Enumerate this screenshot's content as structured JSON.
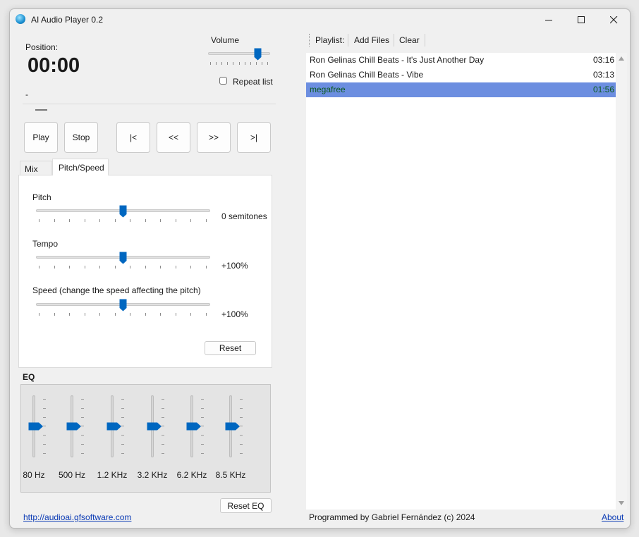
{
  "window": {
    "title": "AI Audio Player 0.2"
  },
  "position": {
    "label": "Position:",
    "time": "00:00",
    "status": "-"
  },
  "volume": {
    "label": "Volume",
    "level": 0.8
  },
  "repeat": {
    "label": "Repeat list",
    "checked": false
  },
  "transport": {
    "play": "Play",
    "stop": "Stop",
    "first": "|<",
    "rewind": "<<",
    "forward": ">>",
    "last": ">|"
  },
  "tabs": [
    {
      "label": "Mix",
      "active": false
    },
    {
      "label": "Pitch/Speed",
      "active": true
    }
  ],
  "pitch_speed": {
    "pitch": {
      "label": "Pitch",
      "value": "0 semitones",
      "level": 0.5
    },
    "tempo": {
      "label": "Tempo",
      "value": "+100%",
      "level": 0.5
    },
    "speed": {
      "label": "Speed (change the speed affecting the pitch)",
      "value": "+100%",
      "level": 0.5
    },
    "reset": "Reset"
  },
  "eq": {
    "label": "EQ",
    "bands": [
      {
        "label": "80 Hz",
        "level": 0.5
      },
      {
        "label": "500 Hz",
        "level": 0.5
      },
      {
        "label": "1.2 KHz",
        "level": 0.5
      },
      {
        "label": "3.2 KHz",
        "level": 0.5
      },
      {
        "label": "6.2 KHz",
        "level": 0.5
      },
      {
        "label": "8.5 KHz",
        "level": 0.5
      }
    ],
    "reset": "Reset EQ"
  },
  "footer": {
    "link": "http://audioai.gfsoftware.com",
    "credit": "Programmed by Gabriel Fernández (c) 2024",
    "about": "About"
  },
  "toolbar": {
    "playlist": "Playlist:",
    "add_files": "Add Files",
    "clear": "Clear"
  },
  "playlist": [
    {
      "name": "Ron Gelinas Chill Beats - It's Just Another Day",
      "duration": "03:16",
      "selected": false
    },
    {
      "name": "Ron Gelinas Chill Beats - Vibe",
      "duration": "03:13",
      "selected": false
    },
    {
      "name": "megafree",
      "duration": "01:56",
      "selected": true
    }
  ],
  "colors": {
    "accent": "#0067c0",
    "selection": "#6c8ee0",
    "selected_text": "#0b5a1e"
  }
}
